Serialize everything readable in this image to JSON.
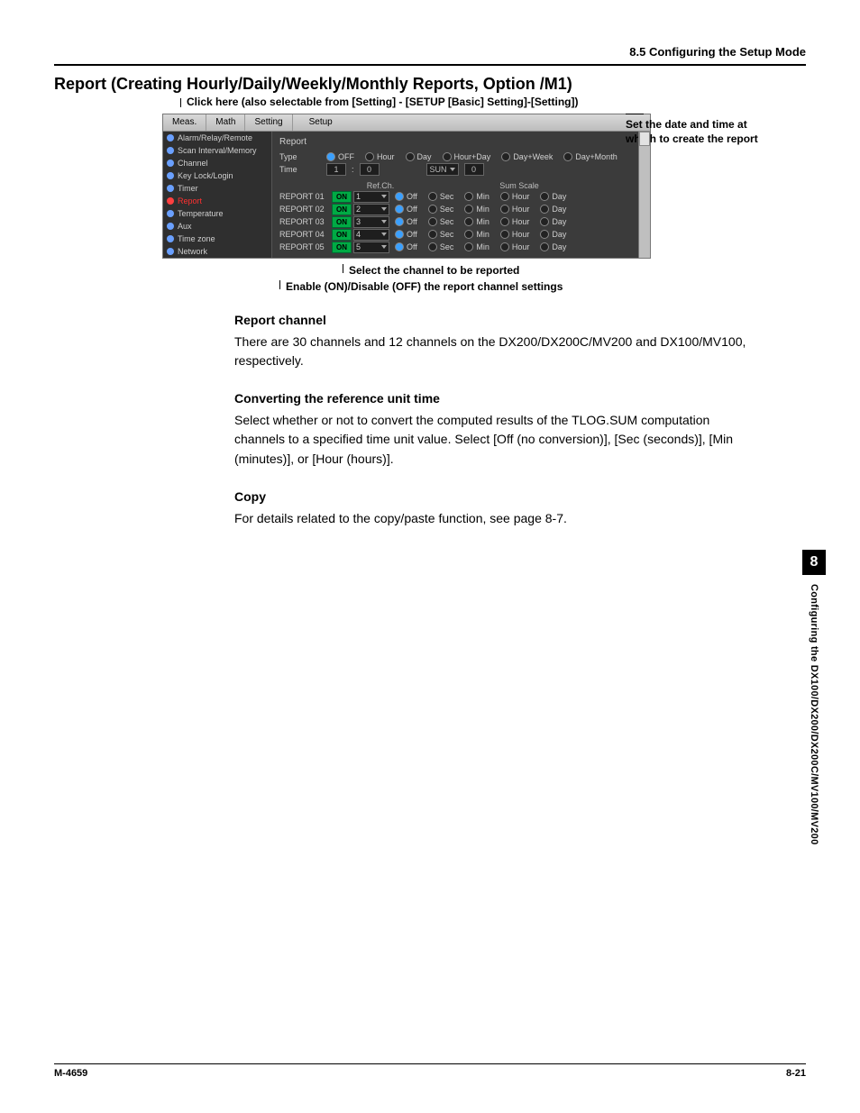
{
  "header": {
    "section": "8.5  Configuring the Setup Mode"
  },
  "title": "Report (Creating Hourly/Daily/Weekly/Monthly Reports, Option /M1)",
  "callouts": {
    "top": "Click here (also selectable from [Setting] - [SETUP [Basic] Setting]-[Setting])",
    "right1": "Set the date and time at",
    "right2": "which to create the report",
    "below1": "Select the channel to be reported",
    "below2": "Enable (ON)/Disable (OFF) the report channel settings"
  },
  "shot": {
    "menus": [
      "Meas.",
      "Math",
      "Setting",
      "Setup"
    ],
    "sidebar": [
      {
        "label": "Alarm/Relay/Remote",
        "active": false
      },
      {
        "label": "Scan Interval/Memory",
        "active": false
      },
      {
        "label": "Channel",
        "active": false
      },
      {
        "label": "Key Lock/Login",
        "active": false
      },
      {
        "label": "Timer",
        "active": false
      },
      {
        "label": "Report",
        "active": true
      },
      {
        "label": "Temperature",
        "active": false
      },
      {
        "label": "Aux",
        "active": false
      },
      {
        "label": "Time zone",
        "active": false
      },
      {
        "label": "Network",
        "active": false
      }
    ],
    "group": "Report",
    "typeLabel": "Type",
    "timeLabel": "Time",
    "typeOptions": [
      "OFF",
      "Hour",
      "Day",
      "Hour+Day",
      "Day+Week",
      "Day+Month"
    ],
    "typeSelected": "OFF",
    "timeHour": "1",
    "timeMin": "0",
    "timeDay": "SUN",
    "timeDate": "0",
    "colRef": "Ref.Ch.",
    "colSum": "Sum Scale",
    "rows": [
      {
        "name": "REPORT 01",
        "on": "ON",
        "ch": "1",
        "sum": "Off"
      },
      {
        "name": "REPORT 02",
        "on": "ON",
        "ch": "2",
        "sum": "Off"
      },
      {
        "name": "REPORT 03",
        "on": "ON",
        "ch": "3",
        "sum": "Off"
      },
      {
        "name": "REPORT 04",
        "on": "ON",
        "ch": "4",
        "sum": "Off"
      },
      {
        "name": "REPORT 05",
        "on": "ON",
        "ch": "5",
        "sum": "Off"
      }
    ],
    "sumOptions": [
      "Sec",
      "Min",
      "Hour",
      "Day"
    ]
  },
  "sections": {
    "s1": {
      "h": "Report channel",
      "p": "There are 30 channels and 12 channels on the DX200/DX200C/MV200 and DX100/MV100, respectively."
    },
    "s2": {
      "h": "Converting the reference unit time",
      "p": "Select whether or not to convert the computed results of the TLOG.SUM computation channels to a specified time unit value.  Select [Off (no conversion)], [Sec (seconds)], [Min (minutes)], or [Hour (hours)]."
    },
    "s3": {
      "h": "Copy",
      "p": "For details related to the copy/paste function, see page 8-7."
    }
  },
  "tab": {
    "num": "8",
    "side": "Configuring the DX100/DX200/DX200C/MV100/MV200"
  },
  "footer": {
    "left": "M-4659",
    "right": "8-21"
  }
}
